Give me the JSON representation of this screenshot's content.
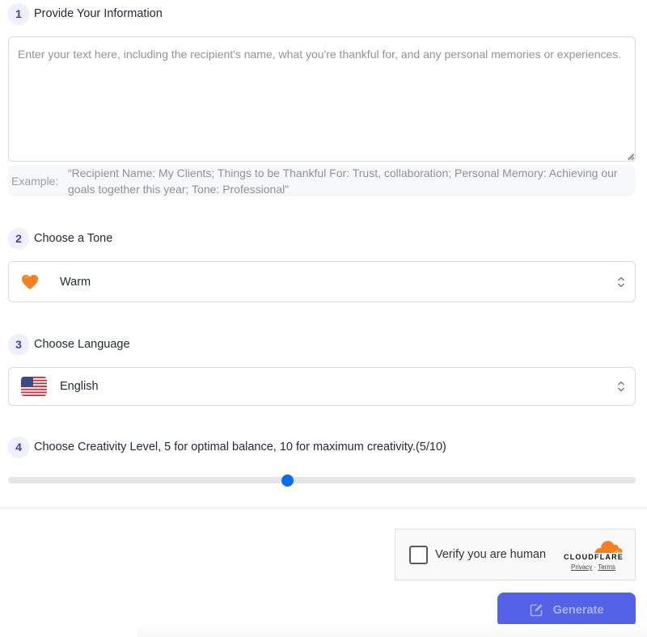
{
  "steps": [
    {
      "number": "1",
      "title": "Provide Your Information"
    },
    {
      "number": "2",
      "title": "Choose a Tone"
    },
    {
      "number": "3",
      "title": "Choose Language"
    },
    {
      "number": "4",
      "title": "Choose Creativity Level, 5 for optimal balance, 10 for maximum creativity.(5/10)"
    }
  ],
  "information": {
    "value": "",
    "placeholder": "Enter your text here, including the recipient's name, what you're thankful for, and any personal memories or experiences.",
    "example_label": "Example:",
    "example_text": "“Recipient Name: My Clients; Things to be Thankful For: Trust, collaboration; Personal Memory: Achieving our goals together this year; Tone: Professional\""
  },
  "tone": {
    "selected": "Warm",
    "icon": "orange-heart-icon"
  },
  "language": {
    "selected": "English",
    "icon": "us-flag-icon"
  },
  "creativity": {
    "value": 5,
    "min": 0,
    "max": 10
  },
  "captcha": {
    "label": "Verify you are human",
    "brand": "CLOUDFLARE",
    "privacy": "Privacy",
    "separator": "·",
    "terms": "Terms",
    "brand_color": "#f38020"
  },
  "generate": {
    "label": "Generate",
    "icon": "edit-icon",
    "color": "#5462e8"
  }
}
